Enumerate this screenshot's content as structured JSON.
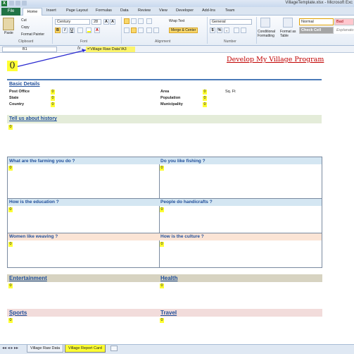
{
  "window": {
    "title": "VillageTemplate.xlsx - Microsoft Exc",
    "app_letter": "X"
  },
  "tabs": {
    "file": "File",
    "home": "Home",
    "items": [
      "Insert",
      "Page Layout",
      "Formulas",
      "Data",
      "Review",
      "View",
      "Developer",
      "Add-Ins",
      "Team"
    ]
  },
  "ribbon": {
    "clipboard": {
      "paste": "Paste",
      "cut": "Cut",
      "copy": "Copy",
      "format_painter": "Format Painter",
      "label": "Clipboard"
    },
    "font": {
      "name": "Century",
      "size": "28",
      "label": "Font",
      "bold": "B",
      "italic": "I",
      "underline": "U"
    },
    "alignment": {
      "wrap_text": "Wrap Text",
      "merge_center": "Merge & Center",
      "label": "Alignment"
    },
    "number": {
      "format": "General",
      "currency": "$",
      "percent": "%",
      "comma": ",",
      "label": "Number"
    },
    "styles": {
      "conditional": "Conditional Formatting",
      "format_table": "Format as Table",
      "normal": "Normal",
      "bad": "Bad",
      "check_cell": "Check Cell",
      "explanatory": "Explanato"
    }
  },
  "formula_bar": {
    "name_box": "B1",
    "fx": "fx",
    "formula": "='Village Raw Data'!A3"
  },
  "sheet": {
    "b1_value": "0",
    "program_title": "Develop My Village Program",
    "basic_details": "Basic Details",
    "left_fields": [
      {
        "label": "Post Office",
        "value": "0"
      },
      {
        "label": "State",
        "value": "0"
      },
      {
        "label": "Country",
        "value": "0"
      }
    ],
    "right_fields": [
      {
        "label": "Area",
        "value": "0",
        "unit": "Sq. Ft"
      },
      {
        "label": "Population",
        "value": "0",
        "unit": ""
      },
      {
        "label": "Municipality",
        "value": "0",
        "unit": ""
      }
    ],
    "history": {
      "label": "Tell us about history",
      "value": "0"
    },
    "questions": [
      {
        "label": "What are the farming you do ?",
        "value": "0"
      },
      {
        "label": "Do you like fishing ?",
        "value": "0"
      },
      {
        "label": "How is the education ?",
        "value": "0"
      },
      {
        "label": "People do handicrafts ?",
        "value": "0"
      },
      {
        "label": "Women like weaving ?",
        "value": "0"
      },
      {
        "label": "How is the culture ?",
        "value": "0"
      }
    ],
    "entertainment": {
      "label": "Entertainment",
      "value": "0"
    },
    "health": {
      "label": "Health",
      "value": "0"
    },
    "sports": {
      "label": "Sports",
      "value": "0"
    },
    "travel": {
      "label": "Travel",
      "value": "0"
    }
  },
  "sheet_tabs": [
    "Village Raw Data",
    "Village Report Card"
  ],
  "colors": {
    "accent_blue": "#1f4e9a",
    "highlight": "#ffff33",
    "title_red": "#c00000"
  }
}
